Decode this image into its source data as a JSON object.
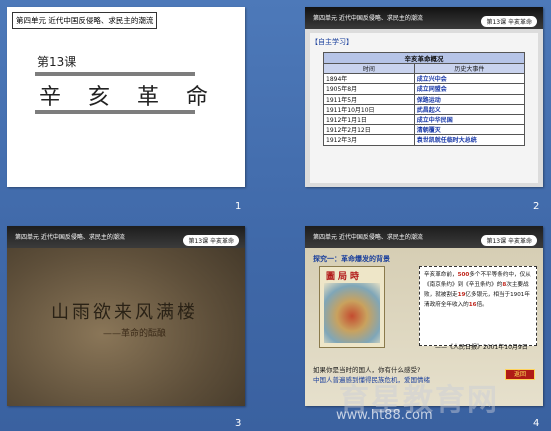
{
  "slides": [
    {
      "number": "1",
      "unit": "第四单元 近代中国反侵略、求民主的潮流",
      "lesson": "第13课",
      "title": "辛 亥 革 命"
    },
    {
      "number": "2",
      "unit": "第四单元 近代中国反侵略、求民主的潮流",
      "badge": "第13课 辛亥革命",
      "section": "【自主学习】",
      "table": {
        "title": "辛亥革命概况",
        "headers": [
          "时间",
          "历史大事件"
        ],
        "rows": [
          [
            "1894年",
            "成立兴中会"
          ],
          [
            "1905年8月",
            "成立同盟会"
          ],
          [
            "1911年5月",
            "保路运动"
          ],
          [
            "1911年10月10日",
            "武昌起义"
          ],
          [
            "1912年1月1日",
            "成立中华民国"
          ],
          [
            "1912年2月12日",
            "清朝覆灭"
          ],
          [
            "1912年3月",
            "袁世凯就任临时大总统"
          ]
        ]
      }
    },
    {
      "number": "3",
      "unit": "第四单元 近代中国反侵略、求民主的潮流",
      "badge": "第13课 辛亥革命",
      "title": "山雨欲来风满楼",
      "subtitle": "——革命的酝酿"
    },
    {
      "number": "4",
      "unit": "第四单元 近代中国反侵略、求民主的潮流",
      "badge": "第13课 辛亥革命",
      "question": "探究一：革命爆发的背景",
      "poster_title": "圖局時",
      "quote_parts": [
        "辛亥革命前，",
        "500",
        "多个不平等条约中，仅从《南京条约》到《辛丑条约》的",
        "8",
        "次主要战败，就被割走",
        "19",
        "亿多银元，相当于1901年清政府全年收入的",
        "16",
        "倍。"
      ],
      "source": "——《人民日报》2001年10月9日",
      "footer1": "如果你是当时的国人，你有什么感受?",
      "footer2": "中国人普遍感到懂得民族危机，爱国情绪",
      "button": "返回"
    }
  ],
  "watermark": {
    "line1": "育星教育网",
    "line2": "www.ht88.com"
  },
  "colors": {
    "desktop": "#4070b0",
    "table_event": "#1838a8",
    "highlight": "#c0281e"
  }
}
